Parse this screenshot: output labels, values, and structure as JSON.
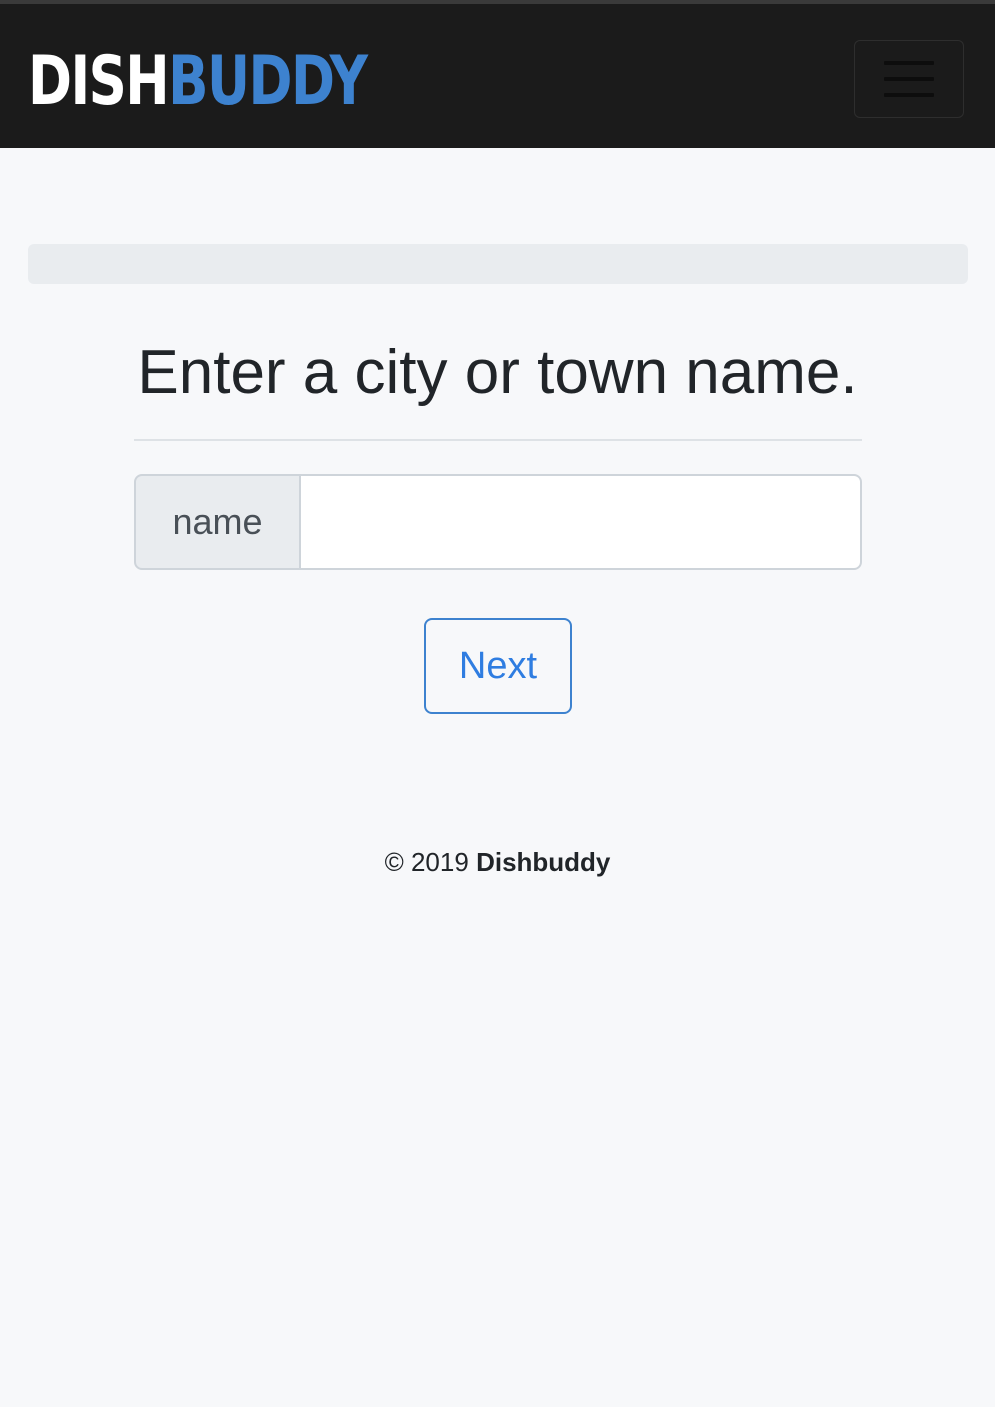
{
  "navbar": {
    "brand_part1": "DISH",
    "brand_part2": "BUDDY",
    "brand_colors": {
      "part1": "#ffffff",
      "part2": "#3d82cf"
    },
    "background": "#1b1b1b",
    "menu_icon": "hamburger-icon"
  },
  "progress": {
    "value_percent": 0
  },
  "main": {
    "heading": "Enter a city or town name.",
    "input": {
      "label": "name",
      "value": "",
      "placeholder": ""
    },
    "next_button_label": "Next",
    "accent_color": "#2f7de1"
  },
  "footer": {
    "copyright": "© 2019",
    "brand": "Dishbuddy"
  }
}
